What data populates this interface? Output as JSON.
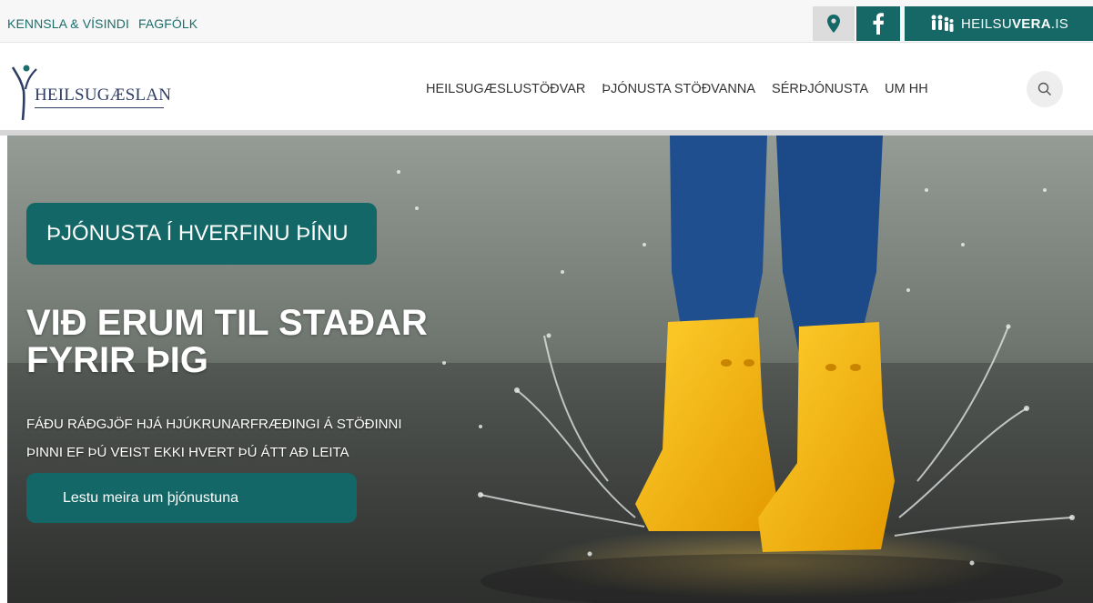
{
  "topbar": {
    "links": [
      "KENNSLA & VÍSINDI",
      "FAGFÓLK"
    ],
    "heilsuvera": {
      "prefix": "HEILSU",
      "bold": "VERA",
      "suffix": ".IS"
    },
    "icons": {
      "map": "map-pin-icon",
      "facebook": "facebook-icon",
      "heilsuvera": "people-icon"
    }
  },
  "header": {
    "logo_text": "HEILSUGÆSLAN",
    "nav": [
      "HEILSUGÆSLUSTÖÐVAR",
      "ÞJÓNUSTA STÖÐVANNA",
      "SÉRÞJÓNUSTA",
      "UM HH"
    ],
    "search_icon": "search-icon"
  },
  "hero": {
    "tag": "ÞJÓNUSTA Í HVERFINU ÞÍNU",
    "headline_line1": "VIÐ ERUM TIL STAÐAR",
    "headline_line2": "FYRIR ÞIG",
    "sub_line1": "FÁÐU RÁÐGJÖF HJÁ HJÚKRUNARFRÆÐINGI Á STÖÐINNI",
    "sub_line2": "ÞINNI EF ÞÚ VEIST EKKI HVERT ÞÚ ÁTT AÐ LEITA",
    "cta": "Lestu meira um þjónustuna"
  },
  "colors": {
    "brand_teal": "#156866",
    "logo_navy": "#2e3d64",
    "boots_yellow": "#f2b40f",
    "jeans_blue": "#1e4f8c"
  }
}
